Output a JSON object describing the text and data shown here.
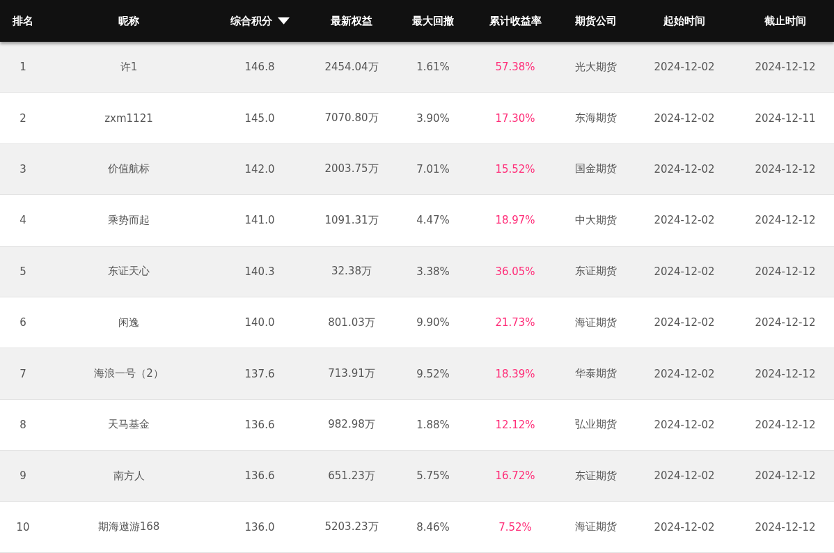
{
  "table": {
    "columns": [
      {
        "label": "排名",
        "sorted": false
      },
      {
        "label": "昵称",
        "sorted": false
      },
      {
        "label": "综合积分",
        "sorted": true
      },
      {
        "label": "最新权益",
        "sorted": false
      },
      {
        "label": "最大回撤",
        "sorted": false
      },
      {
        "label": "累计收益率",
        "sorted": false
      },
      {
        "label": "期货公司",
        "sorted": false
      },
      {
        "label": "起始时间",
        "sorted": false
      },
      {
        "label": "截止时间",
        "sorted": false
      }
    ],
    "rows": [
      {
        "rank": "1",
        "nickname": "许1",
        "score": "146.8",
        "equity": "2454.04万",
        "drawdown": "1.61%",
        "return": "57.38%",
        "company": "光大期货",
        "start": "2024-12-02",
        "end": "2024-12-12"
      },
      {
        "rank": "2",
        "nickname": "zxm1121",
        "score": "145.0",
        "equity": "7070.80万",
        "drawdown": "3.90%",
        "return": "17.30%",
        "company": "东海期货",
        "start": "2024-12-02",
        "end": "2024-12-11"
      },
      {
        "rank": "3",
        "nickname": "价值航标",
        "score": "142.0",
        "equity": "2003.75万",
        "drawdown": "7.01%",
        "return": "15.52%",
        "company": "国金期货",
        "start": "2024-12-02",
        "end": "2024-12-12"
      },
      {
        "rank": "4",
        "nickname": "乘势而起",
        "score": "141.0",
        "equity": "1091.31万",
        "drawdown": "4.47%",
        "return": "18.97%",
        "company": "中大期货",
        "start": "2024-12-02",
        "end": "2024-12-12"
      },
      {
        "rank": "5",
        "nickname": "东证天心",
        "score": "140.3",
        "equity": "32.38万",
        "drawdown": "3.38%",
        "return": "36.05%",
        "company": "东证期货",
        "start": "2024-12-02",
        "end": "2024-12-12"
      },
      {
        "rank": "6",
        "nickname": "闲逸",
        "score": "140.0",
        "equity": "801.03万",
        "drawdown": "9.90%",
        "return": "21.73%",
        "company": "海证期货",
        "start": "2024-12-02",
        "end": "2024-12-12"
      },
      {
        "rank": "7",
        "nickname": "海浪一号（2）",
        "score": "137.6",
        "equity": "713.91万",
        "drawdown": "9.52%",
        "return": "18.39%",
        "company": "华泰期货",
        "start": "2024-12-02",
        "end": "2024-12-12"
      },
      {
        "rank": "8",
        "nickname": "天马基金",
        "score": "136.6",
        "equity": "982.98万",
        "drawdown": "1.88%",
        "return": "12.12%",
        "company": "弘业期货",
        "start": "2024-12-02",
        "end": "2024-12-12"
      },
      {
        "rank": "9",
        "nickname": "南方人",
        "score": "136.6",
        "equity": "651.23万",
        "drawdown": "5.75%",
        "return": "16.72%",
        "company": "东证期货",
        "start": "2024-12-02",
        "end": "2024-12-12"
      },
      {
        "rank": "10",
        "nickname": "期海遨游168",
        "score": "136.0",
        "equity": "5203.23万",
        "drawdown": "8.46%",
        "return": "7.52%",
        "company": "海证期货",
        "start": "2024-12-02",
        "end": "2024-12-12"
      }
    ]
  }
}
